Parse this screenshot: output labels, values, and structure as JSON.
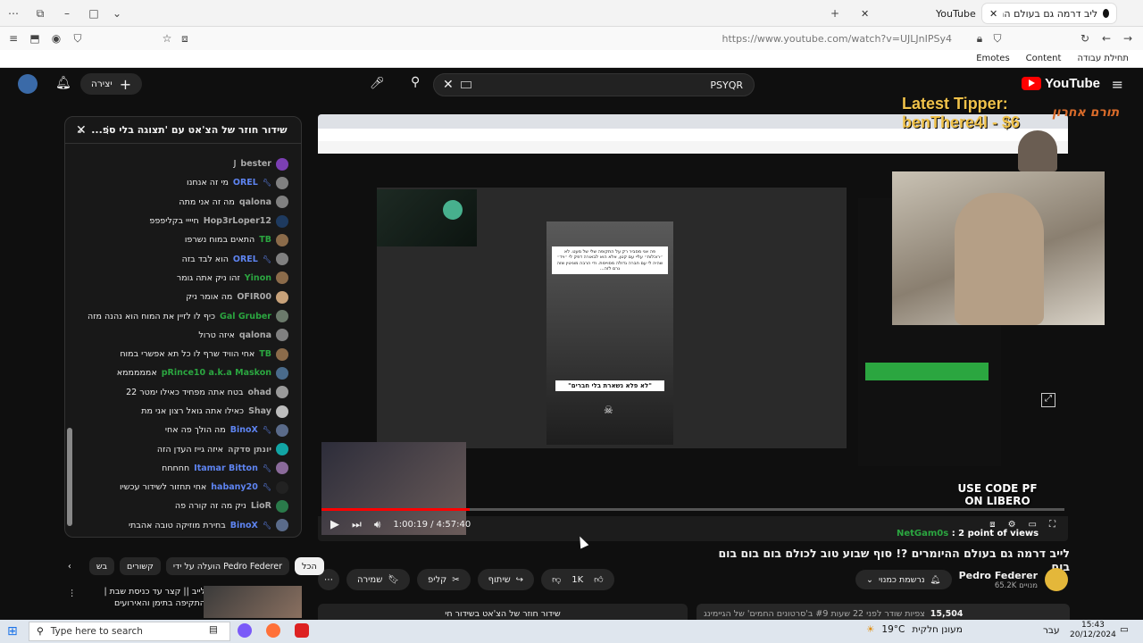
{
  "browser": {
    "tabs": [
      {
        "title": "ליב דרמה גם בעולם ההיומרים ?!",
        "active": true
      },
      {
        "title": "YouTube",
        "active": false
      }
    ],
    "url": "https://www.youtube.com/watch?v=UJLJnIPSy4",
    "bookmarks": [
      "Emotes",
      "Content",
      "תחילת עבודה"
    ]
  },
  "yt": {
    "logo": "YouTube",
    "search_value": "PSYQR",
    "create_label": "יצירה"
  },
  "chat": {
    "title": "שידור חוזר של הצ'אט עם 'תצוגה בלי ספ...",
    "lines": [
      {
        "name": "bester",
        "msg": "J",
        "style": "normal",
        "color": "#7b3fb3"
      },
      {
        "name": "OREL",
        "msg": "מי זה אנחנו",
        "style": "mod",
        "color": "#808080"
      },
      {
        "name": "qalona",
        "msg": "מה זה אני מתה",
        "style": "normal",
        "color": "#808080"
      },
      {
        "name": "Hop3rLoper12",
        "msg": "חיייי בקליפפפ",
        "style": "normal",
        "color": "#1e3a5f"
      },
      {
        "name": "TB",
        "msg": "התאים במוח נשרפו",
        "style": "green",
        "color": "#8b6b4a"
      },
      {
        "name": "OREL",
        "msg": "הוא לבד בזה",
        "style": "mod",
        "color": "#808080"
      },
      {
        "name": "Yinon",
        "msg": "זהו ניק אתה גומר",
        "style": "green",
        "color": "#8b6b4a"
      },
      {
        "name": "OFIR00",
        "msg": "מה אומר ניק",
        "style": "normal",
        "color": "#c8a27a"
      },
      {
        "name": "Gal Gruber",
        "msg": "כיף לו לזיין את המוח הוא נהנה מזה",
        "style": "green",
        "color": "#6b7a6b"
      },
      {
        "name": "qalona",
        "msg": "איזה טרול",
        "style": "normal",
        "color": "#808080"
      },
      {
        "name": "TB",
        "msg": "אחי הוויד שרף לו כל תא אפשרי במוח",
        "style": "green",
        "color": "#8b6b4a"
      },
      {
        "name": "pRince10 a.k.a Maskon",
        "msg": "אמממממא",
        "style": "green",
        "color": "#4a6b8b"
      },
      {
        "name": "ohad",
        "msg": "בטח אתה מפחיד כאילו ימטר 22",
        "style": "normal",
        "color": "#9a9a9a"
      },
      {
        "name": "Shay",
        "msg": "כאילו אתה גואל רצון אני מת",
        "style": "normal",
        "color": "#bdbdbd"
      },
      {
        "name": "BinoX",
        "msg": "מה הולך פה אחי",
        "style": "mod",
        "color": "#5a6b8a"
      },
      {
        "name": "יונתן סדקה",
        "msg": "איזה גייז העדן הזה",
        "style": "normal",
        "color": "#12a5a5"
      },
      {
        "name": "Itamar Bitton",
        "msg": "חחחחח",
        "style": "mod",
        "color": "#8a6a9a"
      },
      {
        "name": "habany20",
        "msg": "אחי תחזור לשידור עכשיו",
        "style": "mod",
        "color": "#222222"
      },
      {
        "name": "LioR",
        "msg": "ניק מה זה קורה פה",
        "style": "normal",
        "color": "#2a7a4a"
      },
      {
        "name": "BinoX",
        "msg": "בחירת מוזיקה טובה אהבתי",
        "style": "mod",
        "color": "#5a6b8a"
      }
    ]
  },
  "player": {
    "time": "1:00:19 / 4:57:40",
    "progress": 0.2,
    "tipper_label": "Latest Tipper:",
    "tipper_name": "benThere4l - $6",
    "tipper_hebrew": "תורם אחרון",
    "code_overlay": "USE CODE PF ON LIBERO",
    "viewers_user": "NetGam0s",
    "viewers_text": ": 2 point of views",
    "inner_caption": "\"לא פלא נשארת בלי חברים\""
  },
  "video": {
    "title": "לייב דרמה גם בעולם ההיומרים ?! סוף שבוע טוב לכולם בום בום בום בום",
    "channel": "Pedro Federer",
    "subs": "65.2K מנויים",
    "subscribed_label": "נרשמת כמנוי",
    "like_count": "1K",
    "clip_label": "קליפ",
    "share_label": "שיתוף",
    "save_label": "שמירה",
    "views": "15,504",
    "desc": "צפיות  שודר לפני 22 שעות  #9 ב'סרטונים החמים' של הגיימינג",
    "comment_box": "שידור חוזר של הצ'אט בשידור חי"
  },
  "sidebar_chips": [
    "הכל",
    "הועלה על ידי Pedro Federer",
    "קשורים",
    "בש"
  ],
  "recommend": {
    "title": "לייב || קצר עד כניסת שבת | התקיפה בתימן והאירועים האחרונים | חרבות..."
  },
  "taskbar": {
    "search_placeholder": "Type here to search",
    "weather": "19°C",
    "weather_text": "מעונן חלקית",
    "lang": "עבר",
    "time": "15:43",
    "date": "20/12/2024"
  }
}
